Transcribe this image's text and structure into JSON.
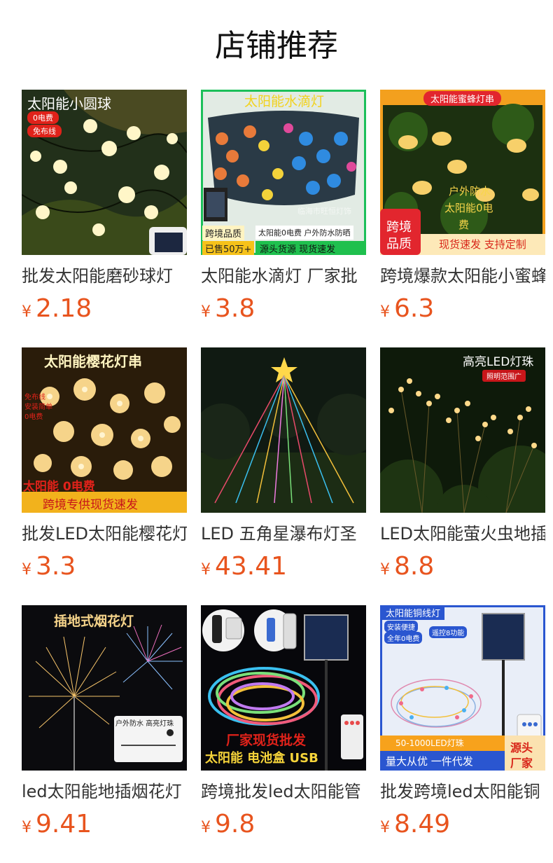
{
  "header": {
    "title": "店铺推荐"
  },
  "currency": "¥",
  "products": [
    {
      "title": "批发太阳能磨砂球灯",
      "price": "2.18",
      "overlay": {
        "main": "太阳能小圆球",
        "tag1": "0电费",
        "tag2": "免布线"
      }
    },
    {
      "title": "太阳能水滴灯 厂家批",
      "price": "3.8",
      "overlay": {
        "main": "太阳能水滴灯",
        "wm": "临海市旺恒灯饰",
        "b1": "跨境品质",
        "b2": "已售50万+",
        "b3": "太阳能0电费 户外防水防晒",
        "b4": "源头货源  现货速发"
      }
    },
    {
      "title": "跨境爆款太阳能小蜜蜂",
      "price": "6.3",
      "overlay": {
        "main": "太阳能蜜蜂灯串",
        "mid1": "户外防水",
        "mid2": "太阳能0电",
        "mid3": "费",
        "badge1": "跨境",
        "badge2": "品质",
        "bottom": "现货速发 支持定制"
      }
    },
    {
      "title": "批发LED太阳能樱花灯",
      "price": "3.3",
      "overlay": {
        "main": "太阳能樱花灯串",
        "side1": "免布线",
        "side2": "安装简单",
        "side3": "0电费",
        "left": "太阳能 0电费",
        "bottom": "跨境专供现货速发"
      }
    },
    {
      "title": "LED 五角星瀑布灯圣",
      "price": "43.41",
      "overlay": {}
    },
    {
      "title": "LED太阳能萤火虫地插",
      "price": "8.8",
      "overlay": {
        "main": "高亮LED灯珠",
        "sub": "照明范围广"
      }
    },
    {
      "title": "led太阳能地插烟花灯",
      "price": "9.41",
      "overlay": {
        "main": "插地式烟花灯",
        "tag": "户外防水 高亮灯珠"
      }
    },
    {
      "title": "跨境批发led太阳能管",
      "price": "9.8",
      "overlay": {
        "l1": "厂家现货批发",
        "l2": "太阳能  电池盒  USB"
      }
    },
    {
      "title": "批发跨境led太阳能铜",
      "price": "8.49",
      "overlay": {
        "main": "太阳能铜线灯",
        "c1": "安装便捷",
        "c2": "遥控8功能",
        "c3": "全年0电费",
        "bar1": "50-1000LED灯珠",
        "bar2": "量大从优 一件代发",
        "corner1": "源头",
        "corner2": "厂家"
      }
    }
  ]
}
